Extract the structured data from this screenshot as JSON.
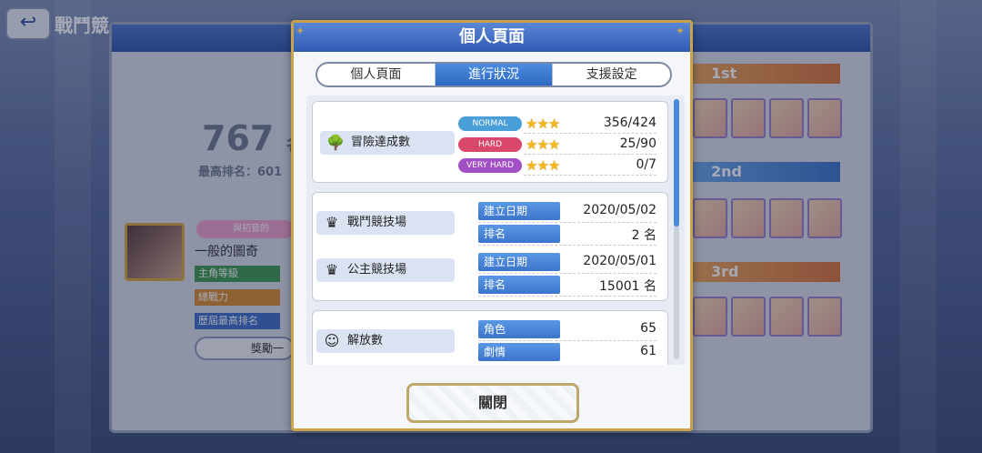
{
  "background": {
    "title": "戰鬥競",
    "rank_number": "767",
    "rank_suffix": "名",
    "best_rank": "最高排名：601",
    "badge": "與初音的",
    "username": "一般的圖奇",
    "rows": [
      "主角等級",
      "總戰力",
      "歷屆最高排名"
    ],
    "reward_button": "獎勵一",
    "rank_labels": [
      "1st",
      "2nd",
      "3rd"
    ]
  },
  "dialog": {
    "title": "個人頁面",
    "tabs": [
      "個人頁面",
      "進行狀況",
      "支援設定"
    ],
    "adventure": {
      "label": "冒險達成數",
      "rows": [
        {
          "difficulty": "NORMAL",
          "stars": "★★★",
          "value": "356/424",
          "color": "#4a9fd8"
        },
        {
          "difficulty": "HARD",
          "stars": "★★★",
          "value": "25/90",
          "color": "#d9476a"
        },
        {
          "difficulty": "VERY HARD",
          "stars": "★★★",
          "value": "0/7",
          "color": "#a24ec4"
        }
      ]
    },
    "arena": {
      "label": "戰鬥競技場",
      "date_label": "建立日期",
      "date_value": "2020/05/02",
      "rank_label": "排名",
      "rank_value": "2 名"
    },
    "princess_arena": {
      "label": "公主競技場",
      "date_label": "建立日期",
      "date_value": "2020/05/01",
      "rank_label": "排名",
      "rank_value": "15001 名"
    },
    "unlocks": {
      "label": "解放數",
      "character_label": "角色",
      "character_value": "65",
      "story_label": "劇情",
      "story_value": "61"
    },
    "close_label": "關閉"
  },
  "colors": {
    "header_blue": "#2f5cb4",
    "active_tab": "#2d68c0",
    "label_blue": "#3b75cc",
    "gold_border": "#c9a24a",
    "star": "#f5b81c"
  }
}
